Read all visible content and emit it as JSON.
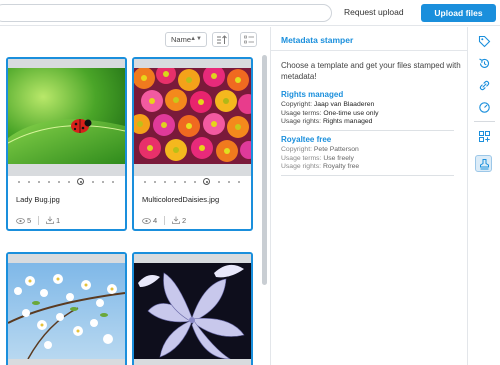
{
  "header": {
    "search_placeholder": "",
    "request_upload": "Request upload",
    "upload_files": "Upload files"
  },
  "toolbar": {
    "sort_value": "Name"
  },
  "files": [
    {
      "name": "Lady Bug.jpg",
      "views": "5",
      "downloads": "1"
    },
    {
      "name": "MulticoloredDaisies.jpg",
      "views": "4",
      "downloads": "2"
    },
    {
      "name": "",
      "views": "",
      "downloads": ""
    },
    {
      "name": "",
      "views": "",
      "downloads": ""
    }
  ],
  "panel": {
    "title": "Metadata stamper",
    "intro": "Choose a template and get your files stamped with metadata!",
    "templates": [
      {
        "name": "Rights managed",
        "rows": [
          {
            "k": "Copyright: ",
            "v": "Jaap van Blaaderen"
          },
          {
            "k": "Usage terms: ",
            "v": "One-time use only"
          },
          {
            "k": "Usage rights: ",
            "v": "Rights managed"
          }
        ]
      },
      {
        "name": "Royaltee free",
        "rows": [
          {
            "k": "Copyright: ",
            "v": "Pete Patterson"
          },
          {
            "k": "Usage terms: ",
            "v": "Use freely"
          },
          {
            "k": "Usage rights: ",
            "v": "Royalty free"
          }
        ]
      }
    ]
  },
  "rail_icons": [
    "tag-icon",
    "history-icon",
    "link-icon",
    "expire-icon",
    "grid-add-icon",
    "stamp-icon"
  ],
  "colors": {
    "accent": "#1a8fdc",
    "selected_border": "#1a8fdc"
  }
}
